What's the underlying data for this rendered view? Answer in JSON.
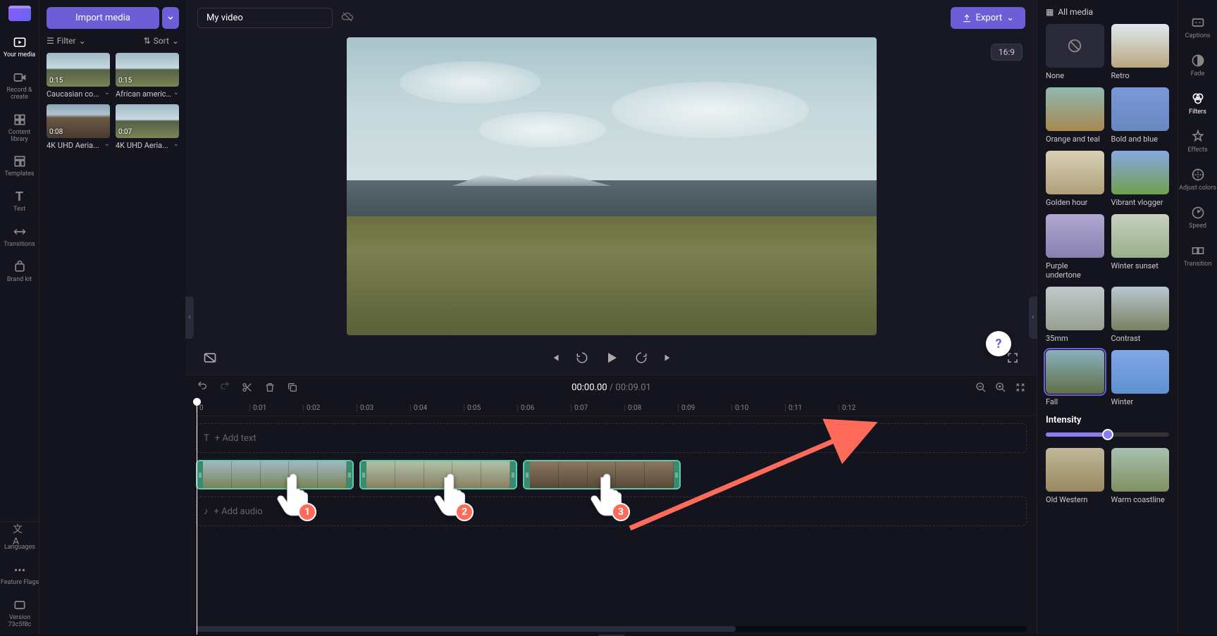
{
  "nav": {
    "items": [
      {
        "label": "Your media",
        "icon": "media"
      },
      {
        "label": "Record & create",
        "icon": "record"
      },
      {
        "label": "Content library",
        "icon": "library"
      },
      {
        "label": "Templates",
        "icon": "templates"
      },
      {
        "label": "Text",
        "icon": "text"
      },
      {
        "label": "Transitions",
        "icon": "transitions"
      },
      {
        "label": "Brand kit",
        "icon": "brand"
      }
    ],
    "bottom": [
      {
        "label": "Languages",
        "icon": "lang"
      },
      {
        "label": "Feature Flags",
        "icon": "flags"
      },
      {
        "label": "Version 73c5f8c",
        "icon": "version"
      }
    ]
  },
  "media": {
    "import": "Import media",
    "filter": "Filter",
    "sort": "Sort",
    "clips": [
      {
        "dur": "0:15",
        "name": "Caucasian co..."
      },
      {
        "dur": "0:15",
        "name": "African american..."
      },
      {
        "dur": "0:08",
        "name": "4K UHD Aeria..."
      },
      {
        "dur": "0:07",
        "name": "4K UHD Aeria..."
      }
    ]
  },
  "project": {
    "title": "My video",
    "aspect": "16:9",
    "export": "Export"
  },
  "controls": {
    "time_current": "00:00.00",
    "time_sep": " / ",
    "time_total": "00:09.01"
  },
  "timeline": {
    "ticks": [
      "0",
      "0:01",
      "0:02",
      "0:03",
      "0:04",
      "0:05",
      "0:06",
      "0:07",
      "0:08",
      "0:09",
      "0:10",
      "0:11",
      "0:12"
    ],
    "addText": "+ Add text",
    "addAudio": "+ Add audio",
    "clips": [
      224,
      224,
      224
    ]
  },
  "filters": {
    "header": "All media",
    "items": [
      {
        "name": "None",
        "tint": "none"
      },
      {
        "name": "Retro",
        "tint": "linear-gradient(180deg,#dfe8ee,#b8a880)"
      },
      {
        "name": "Orange and teal",
        "tint": "linear-gradient(180deg,#8fb8b0,#a88850)"
      },
      {
        "name": "Bold and blue",
        "tint": "linear-gradient(180deg,#7a98d8,#6888c0)"
      },
      {
        "name": "Golden hour",
        "tint": "linear-gradient(180deg,#d8d0b8,#b0a078)"
      },
      {
        "name": "Vibrant vlogger",
        "tint": "linear-gradient(180deg,#88a8e0,#70a050)"
      },
      {
        "name": "Purple undertone",
        "tint": "linear-gradient(180deg,#b0a8d0,#8880b0)"
      },
      {
        "name": "Winter sunset",
        "tint": "linear-gradient(180deg,#c8d0c0,#98b088)"
      },
      {
        "name": "35mm",
        "tint": "linear-gradient(180deg,#c0c8cc,#98a090)"
      },
      {
        "name": "Contrast",
        "tint": "linear-gradient(180deg,#b8c8d0,#788060)"
      },
      {
        "name": "Fall",
        "tint": "linear-gradient(180deg,#88b0c0,#607048)",
        "selected": true
      },
      {
        "name": "Winter",
        "tint": "linear-gradient(180deg,#80a8e8,#6090d0)"
      },
      {
        "name": "Old Western",
        "tint": "linear-gradient(180deg,#c0b898,#988860)"
      },
      {
        "name": "Warm coastline",
        "tint": "linear-gradient(180deg,#a8c0b0,#809060)"
      }
    ],
    "intensity_label": "Intensity",
    "intensity_value": 50
  },
  "rail": [
    {
      "label": "Captions",
      "icon": "cc"
    },
    {
      "label": "Fade",
      "icon": "fade"
    },
    {
      "label": "Filters",
      "icon": "filters",
      "active": true
    },
    {
      "label": "Effects",
      "icon": "effects"
    },
    {
      "label": "Adjust colors",
      "icon": "adjust"
    },
    {
      "label": "Speed",
      "icon": "speed"
    },
    {
      "label": "Transition",
      "icon": "transition"
    }
  ],
  "annotations": {
    "hands": [
      "1",
      "2",
      "3"
    ]
  }
}
